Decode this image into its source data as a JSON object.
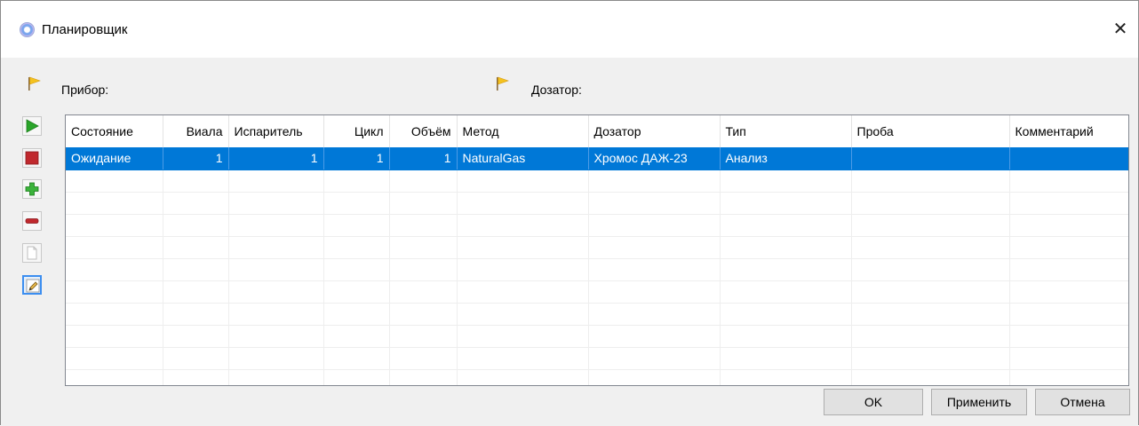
{
  "window": {
    "title": "Планировщик",
    "close_symbol": "✕"
  },
  "header": {
    "device_label": "Прибор:",
    "dosator_label": "Дозатор:"
  },
  "toolbar": {
    "buttons": [
      {
        "name": "run-button",
        "icon": "play-icon",
        "color": "#2aa52a"
      },
      {
        "name": "stop-button",
        "icon": "stop-icon",
        "color": "#c0282d"
      },
      {
        "name": "add-button",
        "icon": "plus-icon",
        "color": "#2aa52a"
      },
      {
        "name": "remove-button",
        "icon": "minus-icon",
        "color": "#c0282d"
      },
      {
        "name": "copy-button",
        "icon": "document-icon",
        "color": "#bdbdbd"
      },
      {
        "name": "edit-button",
        "icon": "pencil-icon",
        "color": "#3c8ef0"
      }
    ]
  },
  "table": {
    "columns": [
      "Состояние",
      "Виала",
      "Испаритель",
      "Цикл",
      "Объём",
      "Метод",
      "Дозатор",
      "Тип",
      "Проба",
      "Комментарий"
    ],
    "rows": [
      [
        "Ожидание",
        "1",
        "1",
        "1",
        "1",
        "NaturalGas",
        "Хромос ДАЖ-23",
        "Анализ",
        "",
        ""
      ]
    ],
    "selected_color": "#0078d7"
  },
  "buttons": {
    "ok": "OK",
    "apply": "Применить",
    "cancel": "Отмена"
  }
}
